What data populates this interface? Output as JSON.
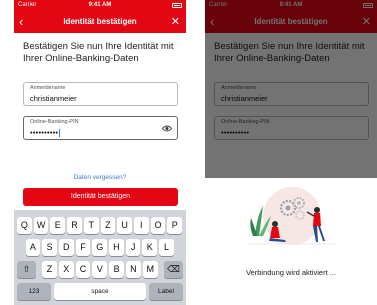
{
  "status_bar": {
    "carrier": "Carrier",
    "time": "9:41 AM"
  },
  "nav": {
    "title": "Identität bestätigen",
    "back_icon": "‹",
    "close_icon": "✕"
  },
  "form": {
    "heading": "Bestätigen Sie nun Ihre Identität mit Ihrer Online-Banking-Daten",
    "username_label": "Anmeldename",
    "username_value": "christianmeier",
    "pin_label": "Online-Banking-PIN",
    "pin_value": "••••••••••",
    "forgot_link": "Daten vergessen?",
    "confirm_button": "Identität bestätigen"
  },
  "keyboard": {
    "row1": [
      "Q",
      "W",
      "E",
      "R",
      "T",
      "Z",
      "U",
      "I",
      "O",
      "P"
    ],
    "row2": [
      "A",
      "S",
      "D",
      "F",
      "G",
      "H",
      "J",
      "K",
      "L"
    ],
    "row3": [
      "Z",
      "X",
      "C",
      "V",
      "B",
      "N",
      "M"
    ],
    "shift_icon": "⇧",
    "delete_icon": "⌫",
    "numbers_key": "123",
    "space_key": "space",
    "enter_key": "Label"
  },
  "overlay": {
    "status": "Verbindung wird aktiviert ..."
  },
  "colors": {
    "brand_red": "#e30613",
    "link_blue": "#3a7bd5",
    "keyboard_bg": "#d1d4da"
  }
}
